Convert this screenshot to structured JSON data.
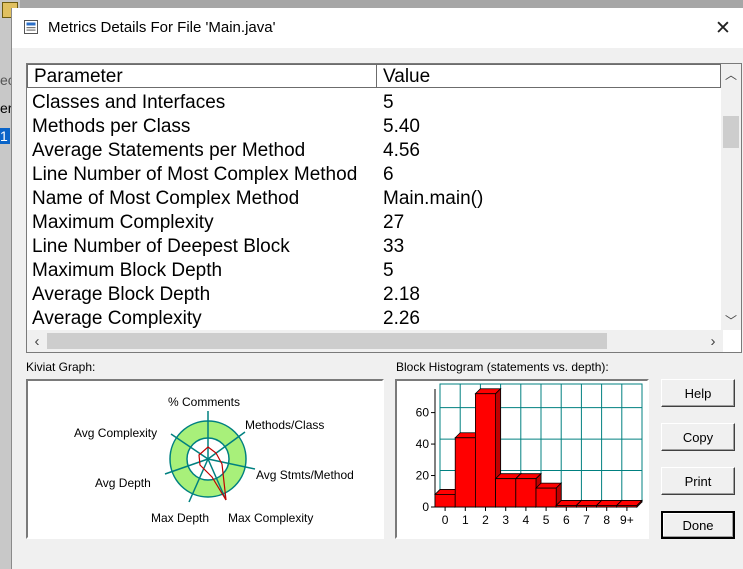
{
  "window": {
    "title": "Metrics Details For File 'Main.java'"
  },
  "table": {
    "headers": {
      "parameter": "Parameter",
      "value": "Value"
    },
    "rows": [
      {
        "parameter": "Classes and Interfaces",
        "value": "5"
      },
      {
        "parameter": "Methods per Class",
        "value": "5.40"
      },
      {
        "parameter": "Average Statements per Method",
        "value": "4.56"
      },
      {
        "parameter": "Line Number of Most Complex Method",
        "value": "6"
      },
      {
        "parameter": "Name of Most Complex Method",
        "value": "Main.main()"
      },
      {
        "parameter": "Maximum Complexity",
        "value": "27"
      },
      {
        "parameter": "Line Number of Deepest Block",
        "value": "33"
      },
      {
        "parameter": "Maximum Block Depth",
        "value": "5"
      },
      {
        "parameter": "Average Block Depth",
        "value": "2.18"
      },
      {
        "parameter": "Average Complexity",
        "value": "2.26"
      }
    ]
  },
  "kiviat": {
    "label": "Kiviat Graph:",
    "axes": {
      "comments": "% Comments",
      "methods_class": "Methods/Class",
      "stmts_method": "Avg Stmts/Method",
      "max_complexity": "Max Complexity",
      "max_depth": "Max Depth",
      "avg_depth": "Avg Depth",
      "avg_complexity": "Avg Complexity"
    },
    "colors": {
      "ring": "#a8f07a",
      "spokes": "#008080",
      "outline": "#c00000"
    }
  },
  "histogram": {
    "label": "Block Histogram (statements vs. depth):",
    "categories": [
      "0",
      "1",
      "2",
      "3",
      "4",
      "5",
      "6",
      "7",
      "8",
      "9+"
    ],
    "yticks": [
      "60",
      "40",
      "20",
      "0"
    ],
    "bar_color": "#ff0000",
    "grid_color": "#008080"
  },
  "chart_data": {
    "type": "bar",
    "title": "Block Histogram (statements vs. depth):",
    "categories": [
      "0",
      "1",
      "2",
      "3",
      "4",
      "5",
      "6",
      "7",
      "8",
      "9+"
    ],
    "values": [
      8,
      44,
      72,
      18,
      18,
      12,
      1,
      1,
      1,
      1
    ],
    "ylim": [
      0,
      75
    ],
    "grid": true
  },
  "buttons": {
    "help": "Help",
    "copy": "Copy",
    "print": "Print",
    "done": "Done"
  },
  "background": {
    "frag1": "ec",
    "frag2": "er",
    "frag3": "1"
  }
}
